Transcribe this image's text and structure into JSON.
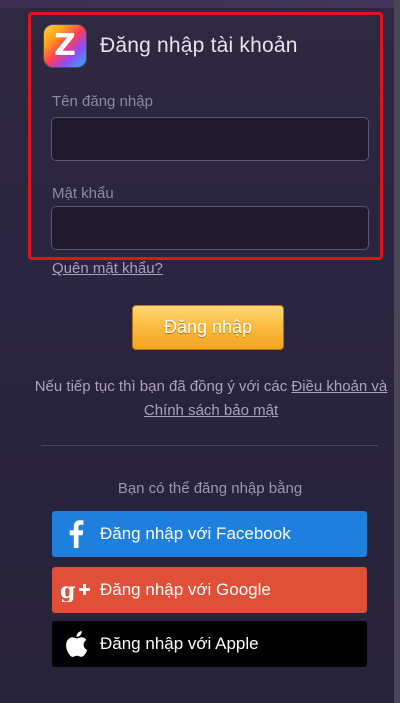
{
  "header": {
    "title": "Đăng nhập tài khoản",
    "logo_letter": "Z"
  },
  "form": {
    "username_label": "Tên đăng nhập",
    "username_value": "",
    "password_label": "Mật khẩu",
    "password_value": "",
    "forgot_link": "Quên mật khẩu?",
    "login_button": "Đăng nhập"
  },
  "terms": {
    "prefix": "Nếu tiếp tục thì bạn đã đồng ý với các ",
    "link": "Điều khoản và Chính sách bảo mật"
  },
  "social": {
    "label": "Bạn có thể đăng nhập bằng",
    "facebook": "Đăng nhập với Facebook",
    "google": "Đăng nhập với Google",
    "apple": "Đăng nhập với Apple"
  },
  "icons": {
    "logo": "zing-logo-icon",
    "facebook": "facebook-icon",
    "google": "google-plus-icon",
    "apple": "apple-icon"
  },
  "colors": {
    "highlight": "#e0141e",
    "login_button": "#fbbd43",
    "facebook": "#1e7fdc",
    "google": "#e05038",
    "apple": "#000000"
  }
}
